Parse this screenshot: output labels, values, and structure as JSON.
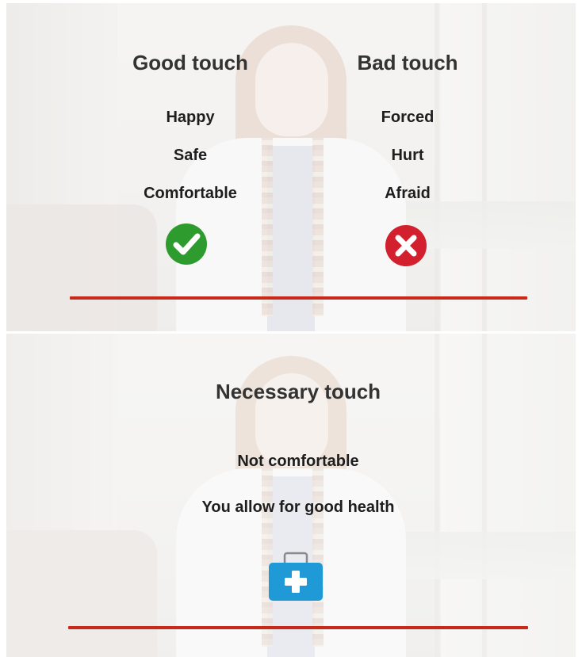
{
  "top_panel": {
    "good": {
      "heading": "Good touch",
      "items": [
        "Happy",
        "Safe",
        "Comfortable"
      ],
      "icon": "check-circle-icon",
      "icon_color": "#2e9b2e"
    },
    "bad": {
      "heading": "Bad touch",
      "items": [
        "Forced",
        "Hurt",
        "Afraid"
      ],
      "icon": "x-circle-icon",
      "icon_color": "#d3202e"
    },
    "divider_color": "#c72a1a"
  },
  "bottom_panel": {
    "heading": "Necessary touch",
    "items": [
      "Not comfortable",
      "You allow for good health"
    ],
    "icon": "first-aid-kit-icon",
    "icon_color": "#1f9ad6",
    "divider_color": "#c72a1a"
  }
}
